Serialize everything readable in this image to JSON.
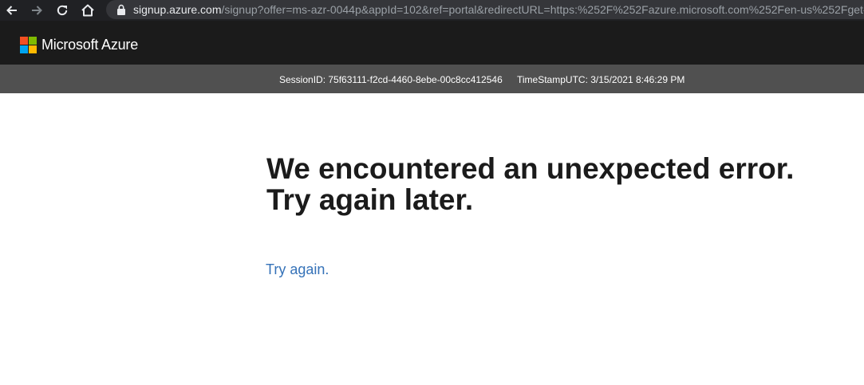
{
  "browser": {
    "url_host": "signup.azure.com",
    "url_path": "/signup?offer=ms-azr-0044p&appId=102&ref=portal&redirectURL=https:%252F%252Fazure.microsoft.com%252Fen-us%252Fget-",
    "icons": [
      "back-icon",
      "forward-icon",
      "reload-icon",
      "home-icon",
      "lock-icon"
    ]
  },
  "header": {
    "brand_name": "Microsoft Azure",
    "logo_colors": [
      "#f25022",
      "#7fba00",
      "#00a4ef",
      "#ffb900"
    ]
  },
  "session": {
    "session_id": "SessionID: 75f63111-f2cd-4460-8ebe-00c8cc412546",
    "timestamp": "TimeStampUTC: 3/15/2021 8:46:29 PM"
  },
  "main": {
    "heading_line1": "We encountered an unexpected error.",
    "heading_line2": "Try again later.",
    "retry_link": "Try again."
  },
  "colors": {
    "browser_bg": "#202124",
    "header_bg": "#1b1b1b",
    "session_bg": "#505050",
    "link": "#3572b8"
  }
}
